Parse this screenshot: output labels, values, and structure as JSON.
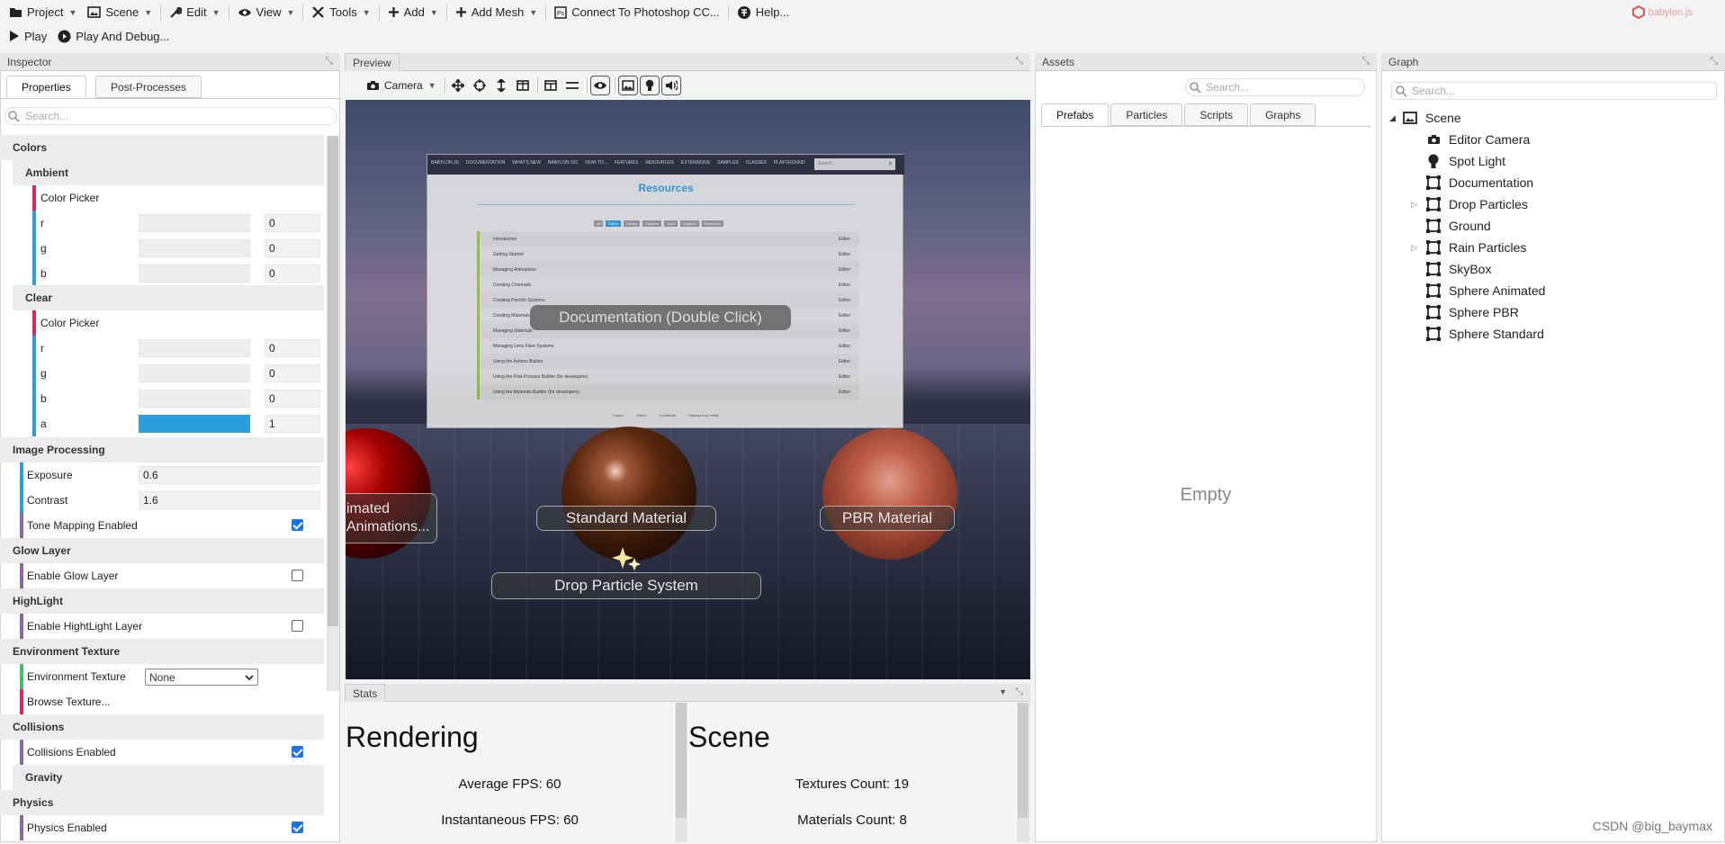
{
  "menu": {
    "project": "Project",
    "scene": "Scene",
    "edit": "Edit",
    "view": "View",
    "tools": "Tools",
    "add": "Add",
    "add_mesh": "Add Mesh",
    "photoshop": "Connect To Photoshop CC...",
    "help": "Help...",
    "play": "Play",
    "play_debug": "Play And Debug...",
    "brand": "babylon.js"
  },
  "inspector": {
    "title": "Inspector",
    "tab_properties": "Properties",
    "tab_post": "Post-Processes",
    "search_placeholder": "Search...",
    "colors": "Colors",
    "ambient": "Ambient",
    "color_picker": "Color Picker",
    "r": "r",
    "g": "g",
    "b": "b",
    "a": "a",
    "ambient_r": "0",
    "ambient_g": "0",
    "ambient_b": "0",
    "clear": "Clear",
    "clear_r": "0",
    "clear_g": "0",
    "clear_b": "0",
    "clear_a": "1",
    "image_processing": "Image Processing",
    "exposure": "Exposure",
    "exposure_val": "0.6",
    "contrast": "Contrast",
    "contrast_val": "1.6",
    "tone_mapping": "Tone Mapping Enabled",
    "glow_layer": "Glow Layer",
    "enable_glow": "Enable Glow Layer",
    "highlight": "HighLight",
    "enable_highlight": "Enable HightLight Layer",
    "env_texture": "Environment Texture",
    "env_texture_label": "Environment Texture",
    "env_texture_value": "None",
    "browse_texture": "Browse Texture...",
    "collisions": "Collisions",
    "collisions_enabled": "Collisions Enabled",
    "gravity": "Gravity",
    "physics": "Physics",
    "physics_enabled": "Physics Enabled"
  },
  "preview": {
    "title": "Preview",
    "camera": "Camera",
    "doc_label": "Documentation (Double Click)",
    "standard_label": "Standard Material",
    "pbr_label": "PBR Material",
    "particle_label": "Drop Particle System",
    "animated_label": "imated\nAnimations...",
    "site_title": "Resources",
    "site_nav": [
      "BABYLON.JS",
      "DOCUMENTATION",
      "WHAT'S NEW",
      "BABYLON 101",
      "HOW TO...",
      "FEATURES",
      "RESOURCES",
      "EXTENSIONS",
      "SAMPLES",
      "CLASSES",
      "PLAYGROUND"
    ],
    "site_rows": [
      "Introduction",
      "Getting Started",
      "Managing Animations",
      "Creating Cinematic",
      "Creating Particle Systems",
      "Creating Materials",
      "Managing Materials",
      "Managing Lens Flare Systems",
      "Using the Actions Builder",
      "Using the Post-Process Builder (for developers)",
      "Using the Materials Builder (for developers)"
    ],
    "site_filters": [
      "All",
      "Editor",
      "Library",
      "Shaders",
      "Tools",
      "Material",
      "Reference"
    ],
    "site_footer": [
      "Forum",
      "Github",
      "Contribute",
      "Deployed by netlify"
    ],
    "site_search": "Search...",
    "site_editor": "Editor"
  },
  "stats": {
    "title": "Stats",
    "rendering": "Rendering",
    "avg_fps": "Average FPS: 60",
    "inst_fps": "Instantaneous FPS: 60",
    "scene": "Scene",
    "textures": "Textures Count: 19",
    "materials": "Materials Count: 8"
  },
  "assets": {
    "title": "Assets",
    "search_placeholder": "Search...",
    "tabs": [
      "Prefabs",
      "Particles",
      "Scripts",
      "Graphs"
    ],
    "empty": "Empty"
  },
  "graph": {
    "title": "Graph",
    "search_placeholder": "Search...",
    "root": "Scene",
    "items": [
      "Editor Camera",
      "Spot Light",
      "Documentation",
      "Drop Particles",
      "Ground",
      "Rain Particles",
      "SkyBox",
      "Sphere Animated",
      "Sphere PBR",
      "Sphere Standard"
    ]
  },
  "watermark": "CSDN @big_baymax",
  "colors": {
    "accent": "#2b9fde",
    "red_bar": "#e0245e",
    "blue_bar": "#2b9fde",
    "purple_bar": "#8e6b9e",
    "green_bar": "#3fbf6f"
  }
}
